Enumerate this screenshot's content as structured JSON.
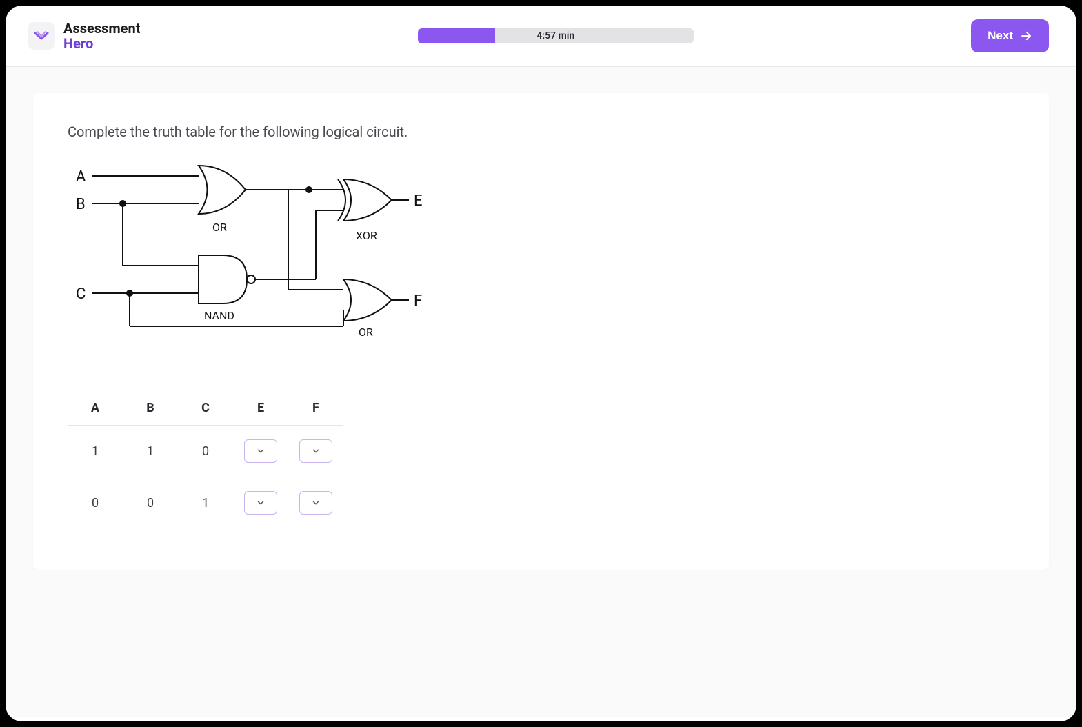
{
  "brand": {
    "line1": "Assessment",
    "line2": "Hero"
  },
  "progress": {
    "label": "4:57 min",
    "fill_percent": 28
  },
  "next_button_label": "Next",
  "question": {
    "prompt": "Complete the truth table for the following logical circuit."
  },
  "circuit": {
    "inputs": [
      "A",
      "B",
      "C"
    ],
    "outputs": [
      "E",
      "F"
    ],
    "gates": [
      {
        "type": "OR",
        "label": "OR",
        "inputs": [
          "A",
          "B"
        ],
        "output": "G1"
      },
      {
        "type": "NAND",
        "label": "NAND",
        "inputs": [
          "B",
          "C"
        ],
        "output": "G2"
      },
      {
        "type": "XOR",
        "label": "XOR",
        "inputs": [
          "G1",
          "G2"
        ],
        "output": "E"
      },
      {
        "type": "OR",
        "label": "OR",
        "inputs": [
          "G1",
          "C"
        ],
        "output": "F"
      }
    ]
  },
  "truth_table": {
    "headers": [
      "A",
      "B",
      "C",
      "E",
      "F"
    ],
    "rows": [
      {
        "A": "1",
        "B": "1",
        "C": "0",
        "E": "",
        "F": ""
      },
      {
        "A": "0",
        "B": "0",
        "C": "1",
        "E": "",
        "F": ""
      }
    ]
  }
}
